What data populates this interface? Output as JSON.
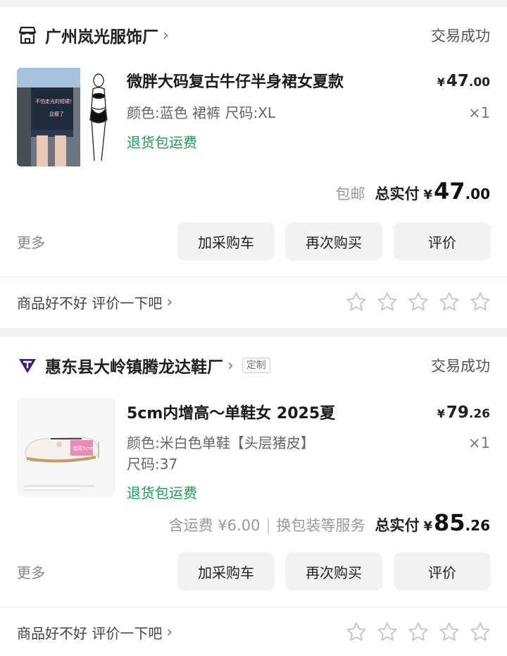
{
  "orders": [
    {
      "shop_name": "广州岚光服饰厂",
      "status": "交易成功",
      "custom_tag": "",
      "product": {
        "title": "微胖大码复古牛仔半身裙女夏款",
        "spec_line1": "颜色:蓝色 裙裤 尺码:XL",
        "spec_line2": "",
        "return_tag": "退货包运费",
        "price_int": "47",
        "price_dec": ".00",
        "qty": "×1"
      },
      "shipping_note": "包邮",
      "extra_service": "",
      "total_label": "总实付",
      "total_int": "47",
      "total_dec": ".00",
      "more_label": "更多",
      "buttons": [
        "加采购车",
        "再次购买",
        "评价"
      ],
      "review_prompt": "商品好不好 评价一下吧"
    },
    {
      "shop_name": "惠东县大岭镇腾龙达鞋厂",
      "status": "交易成功",
      "custom_tag": "定制",
      "product": {
        "title": "5cm内增高～单鞋女 2025夏",
        "spec_line1": "颜色:米白色单鞋【头层猪皮】",
        "spec_line2": "尺码:37",
        "return_tag": "退货包运费",
        "price_int": "79",
        "price_dec": ".26",
        "qty": "×1"
      },
      "shipping_note": "含运费 ¥6.00",
      "extra_service": "换包装等服务",
      "total_label": "总实付",
      "total_int": "85",
      "total_dec": ".26",
      "more_label": "更多",
      "buttons": [
        "加采购车",
        "再次购买",
        "评价"
      ],
      "review_prompt": "商品好不好 评价一下吧"
    }
  ],
  "currency_symbol": "¥",
  "colors": {
    "green": "#1a9e54",
    "shop2_brand": "#3b1e8c"
  },
  "thumb1_text": {
    "caption1": "不怕走光的短裙！",
    "caption2": "显瘦了"
  },
  "thumb2_text": {
    "caption": "增高5cm"
  }
}
